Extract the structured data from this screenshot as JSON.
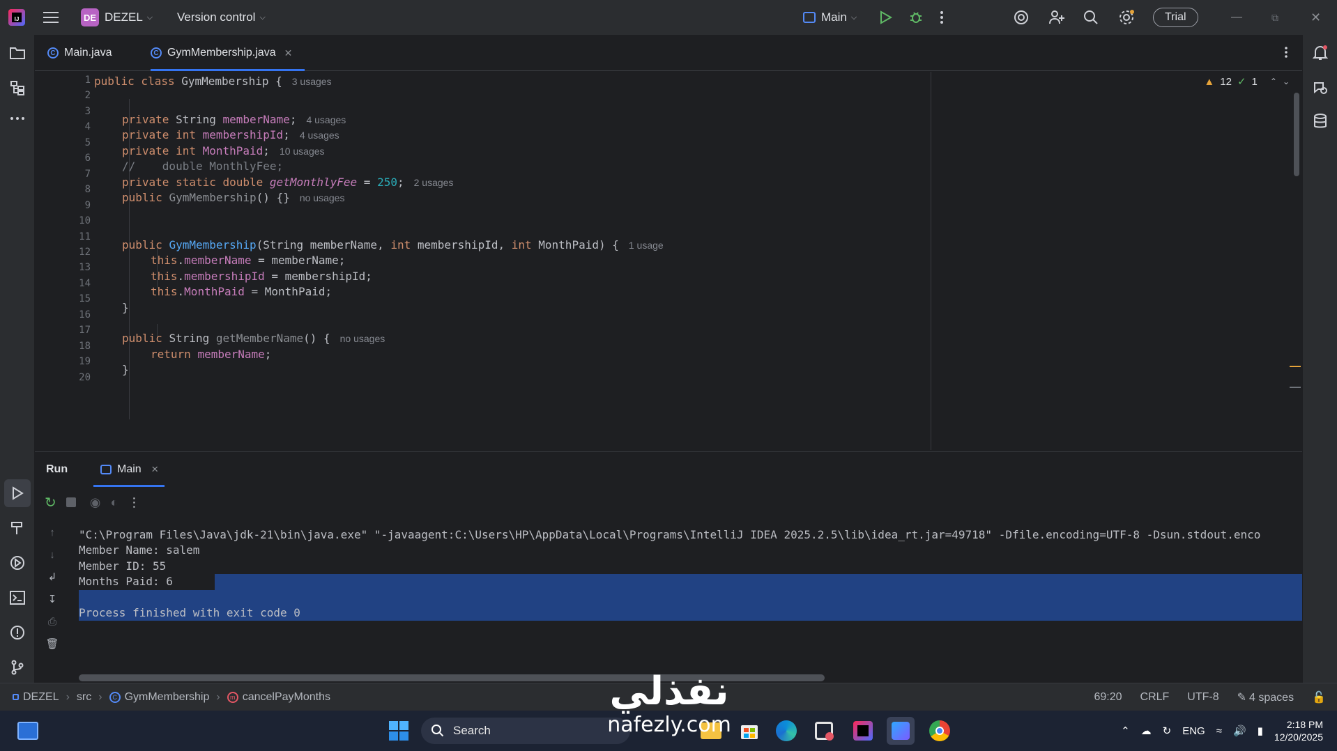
{
  "titlebar": {
    "project_badge": "DE",
    "project_name": "DEZEL",
    "vcs_label": "Version control",
    "run_config": "Main",
    "trial_label": "Trial",
    "colors": {
      "accent": "#3574f0",
      "badge": "#b863c4",
      "run": "#5fb865"
    }
  },
  "tabs": [
    {
      "label": "Main.java",
      "icon": "java-class-icon",
      "active": false
    },
    {
      "label": "GymMembership.java",
      "icon": "java-class-icon",
      "active": true
    }
  ],
  "inspections": {
    "warnings": "12",
    "ok": "1"
  },
  "editor": {
    "line_numbers": [
      "1",
      "2",
      "3",
      "4",
      "5",
      "6",
      "7",
      "8",
      "9",
      "10",
      "11",
      "12",
      "13",
      "14",
      "15",
      "16",
      "17",
      "18",
      "19",
      "20"
    ],
    "l1": {
      "a": "public class ",
      "b": "GymMembership",
      "c": " {",
      "hint": "3 usages"
    },
    "l3": {
      "a": "private ",
      "b": "String ",
      "c": "memberName",
      "d": ";",
      "hint": "4 usages"
    },
    "l4": {
      "a": "private int ",
      "c": "membershipId",
      "d": ";",
      "hint": "4 usages"
    },
    "l5": {
      "a": "private int ",
      "c": "MonthPaid",
      "d": ";",
      "hint": "10 usages"
    },
    "l6": {
      "text": "//    double MonthlyFee;"
    },
    "l7": {
      "a": "private static double ",
      "c": "getMonthlyFee",
      "d": " = ",
      "e": "250",
      "f": ";",
      "hint": "2 usages"
    },
    "l8": {
      "a": "public ",
      "c": "GymMembership",
      "d": "() {}",
      "hint": "no usages"
    },
    "l11": {
      "a": "public ",
      "c": "GymMembership",
      "d": "(String memberName, ",
      "e": "int",
      "f": " membershipId, ",
      "g": "int",
      "h": " MonthPaid) {",
      "hint": "1 usage"
    },
    "l12": {
      "a": "this",
      "b": ".",
      "c": "memberName",
      "d": " = memberName;"
    },
    "l13": {
      "a": "this",
      "b": ".",
      "c": "membershipId",
      "d": " = membershipId;"
    },
    "l14": {
      "a": "this",
      "b": ".",
      "c": "MonthPaid",
      "d": " = MonthPaid;"
    },
    "l15": {
      "text": "}"
    },
    "l17": {
      "a": "public ",
      "b": "String ",
      "c": "getMemberName",
      "d": "() {",
      "hint": "no usages"
    },
    "l18": {
      "a": "return ",
      "c": "memberName",
      "d": ";"
    },
    "l19": {
      "text": "}"
    }
  },
  "run": {
    "title": "Run",
    "tab_label": "Main",
    "console": [
      "\"C:\\Program Files\\Java\\jdk-21\\bin\\java.exe\" \"-javaagent:C:\\Users\\HP\\AppData\\Local\\Programs\\IntelliJ IDEA 2025.2.5\\lib\\idea_rt.jar=49718\" -Dfile.encoding=UTF-8 -Dsun.stdout.enco",
      "Member Name: salem",
      "Member ID: 55",
      "Months Paid: 6",
      "",
      "Process finished with exit code 0"
    ]
  },
  "statusbar": {
    "breadcrumb": [
      "DEZEL",
      "src",
      "GymMembership",
      "cancelPayMonths"
    ],
    "position": "69:20",
    "line_sep": "CRLF",
    "encoding": "UTF-8",
    "indent": "4 spaces"
  },
  "taskbar": {
    "search_label": "Search",
    "lang": "ENG",
    "time": "2:18 PM",
    "date": "12/20/2025"
  },
  "watermark": {
    "arabic": "نفذلي",
    "latin": "nafezly.com"
  }
}
